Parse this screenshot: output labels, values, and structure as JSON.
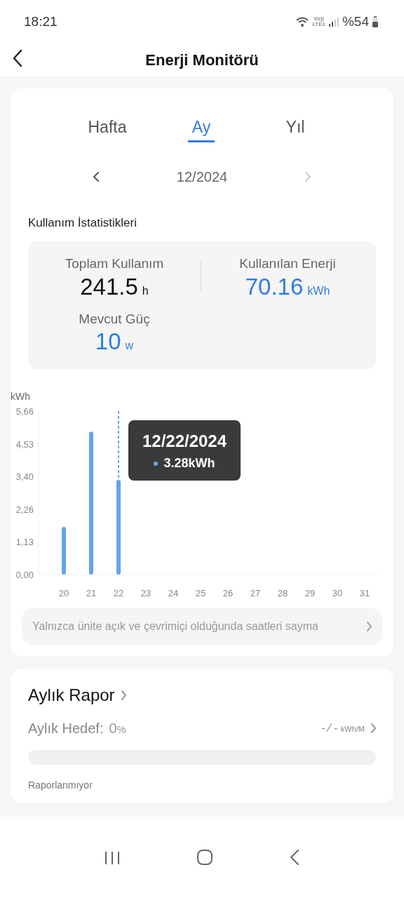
{
  "status_bar": {
    "time": "18:21",
    "volte": "Vo))",
    "lte": "LTE1",
    "battery": "%54"
  },
  "header": {
    "title": "Enerji Monitörü"
  },
  "tabs": [
    {
      "label": "Hafta",
      "selected": false
    },
    {
      "label": "Ay",
      "selected": true
    },
    {
      "label": "Yıl",
      "selected": false
    }
  ],
  "period": {
    "label": "12/2024",
    "prev_disabled": false,
    "next_disabled": true
  },
  "stats": {
    "title": "Kullanım İstatistikleri",
    "items": [
      {
        "label": "Toplam Kullanım",
        "value": "241.5",
        "unit": "h",
        "accent": false
      },
      {
        "label": "Kullanılan Enerji",
        "value": "70.16",
        "unit": "kWh",
        "accent": true
      },
      {
        "label": "Mevcut Güç",
        "value": "10",
        "unit": "w",
        "accent": true
      }
    ]
  },
  "chart_data": {
    "type": "bar",
    "ylabel": "kWh",
    "categories": [
      "20",
      "21",
      "22",
      "23",
      "24",
      "25",
      "26",
      "27",
      "28",
      "29",
      "30",
      "31"
    ],
    "values": [
      1.65,
      4.95,
      3.28,
      null,
      null,
      null,
      null,
      null,
      null,
      null,
      null,
      null
    ],
    "ylim": [
      0,
      5.66
    ],
    "yticks": [
      {
        "value": 0,
        "label": "0,00"
      },
      {
        "value": 1.13,
        "label": "1,13"
      },
      {
        "value": 2.26,
        "label": "2,26"
      },
      {
        "value": 3.4,
        "label": "3,40"
      },
      {
        "value": 4.53,
        "label": "4,53"
      },
      {
        "value": 5.66,
        "label": "5,66"
      }
    ],
    "ref_lines": [
      {
        "axis": "x",
        "value": "22"
      }
    ]
  },
  "tooltip": {
    "date": "12/22/2024",
    "value": "3.28kWh"
  },
  "note": "Yalnızca ünite açık ve çevrimiçi olduğunda saatleri sayma",
  "report": {
    "title": "Aylık Rapor",
    "target_label": "Aylık Hedef:",
    "target_value": "0",
    "target_unit": "%",
    "goal": "- ⁄ -",
    "goal_unit": "kWh/M",
    "status": "Raporlanmıyor"
  }
}
